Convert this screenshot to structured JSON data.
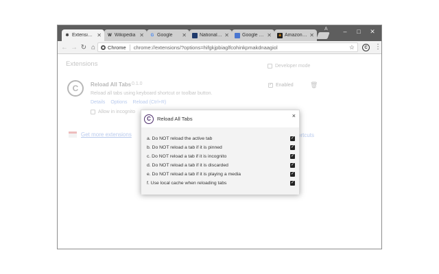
{
  "window": {
    "tabs": [
      {
        "title": "Extensions",
        "favicon": "puzzle-icon",
        "active": true
      },
      {
        "title": "Wikipedia",
        "favicon": "wikipedia-icon",
        "active": false
      },
      {
        "title": "Google",
        "favicon": "google-icon",
        "active": false
      },
      {
        "title": "National ar",
        "favicon": "national-archives-icon",
        "active": false
      },
      {
        "title": "Google Ne",
        "favicon": "google-news-icon",
        "active": false
      },
      {
        "title": "Amazon.co",
        "favicon": "amazon-icon",
        "active": false
      }
    ],
    "profile_label": "A",
    "controls": {
      "minimize": "–",
      "maximize": "□",
      "close": "✕"
    }
  },
  "toolbar": {
    "chip_label": "Chrome",
    "url": "chrome://extensions/?options=hifgkjpbiaglfcohinkpmakdnaagiol"
  },
  "extensions_page": {
    "heading": "Extensions",
    "developer_mode_label": "Developer mode",
    "extension": {
      "name": "Reload All Tabs",
      "version": "0.1.0",
      "description": "Reload all tabs using keyboard shortcut or toolbar button.",
      "links": [
        "Details",
        "Options",
        "Reload (Ctrl+R)"
      ],
      "incognito_label": "Allow in incognito",
      "enabled_label": "Enabled"
    },
    "get_more_label": "Get more extensions",
    "shortcuts_label": "ortcuts"
  },
  "dialog": {
    "title": "Reload All Tabs",
    "close": "×",
    "options": [
      {
        "label": "a. Do NOT reload the active tab",
        "checked": true
      },
      {
        "label": "b. Do NOT reload a tab if it is pinned",
        "checked": true
      },
      {
        "label": "c. Do NOT reload a tab if it is incognito",
        "checked": true
      },
      {
        "label": "d. Do NOT reload a tab if it is discarded",
        "checked": true
      },
      {
        "label": "e. Do NOT reload a tab if it is playing a media",
        "checked": true
      },
      {
        "label": "f. Use local cache when reloading tabs",
        "checked": true
      }
    ]
  }
}
